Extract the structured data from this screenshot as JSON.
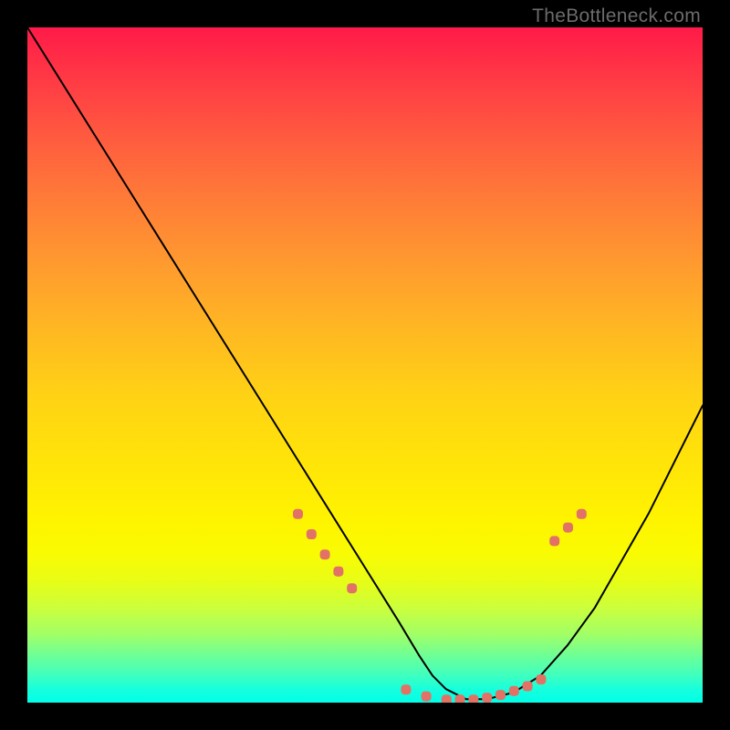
{
  "watermark": "TheBottleneck.com",
  "chart_data": {
    "type": "line",
    "title": "",
    "xlabel": "",
    "ylabel": "",
    "xlim": [
      0,
      100
    ],
    "ylim": [
      0,
      100
    ],
    "series": [
      {
        "name": "curve",
        "x": [
          0,
          5,
          10,
          15,
          20,
          25,
          30,
          35,
          40,
          45,
          50,
          55,
          58,
          60,
          62,
          65,
          68,
          72,
          76,
          80,
          84,
          88,
          92,
          96,
          100
        ],
        "y": [
          100,
          92,
          84,
          76,
          68,
          60,
          52,
          44,
          36,
          28,
          20,
          12,
          7,
          4,
          2,
          0.5,
          0.5,
          1.5,
          4,
          8.5,
          14,
          21,
          28,
          36,
          44
        ]
      }
    ],
    "markers": [
      {
        "x": 40,
        "y": 28
      },
      {
        "x": 42,
        "y": 25
      },
      {
        "x": 44,
        "y": 22
      },
      {
        "x": 46,
        "y": 19.5
      },
      {
        "x": 48,
        "y": 17
      },
      {
        "x": 56,
        "y": 2
      },
      {
        "x": 59,
        "y": 1
      },
      {
        "x": 62,
        "y": 0.5
      },
      {
        "x": 64,
        "y": 0.5
      },
      {
        "x": 66,
        "y": 0.5
      },
      {
        "x": 68,
        "y": 0.8
      },
      {
        "x": 70,
        "y": 1.2
      },
      {
        "x": 72,
        "y": 1.8
      },
      {
        "x": 74,
        "y": 2.5
      },
      {
        "x": 76,
        "y": 3.5
      },
      {
        "x": 78,
        "y": 24
      },
      {
        "x": 80,
        "y": 26
      },
      {
        "x": 82,
        "y": 28
      }
    ]
  }
}
